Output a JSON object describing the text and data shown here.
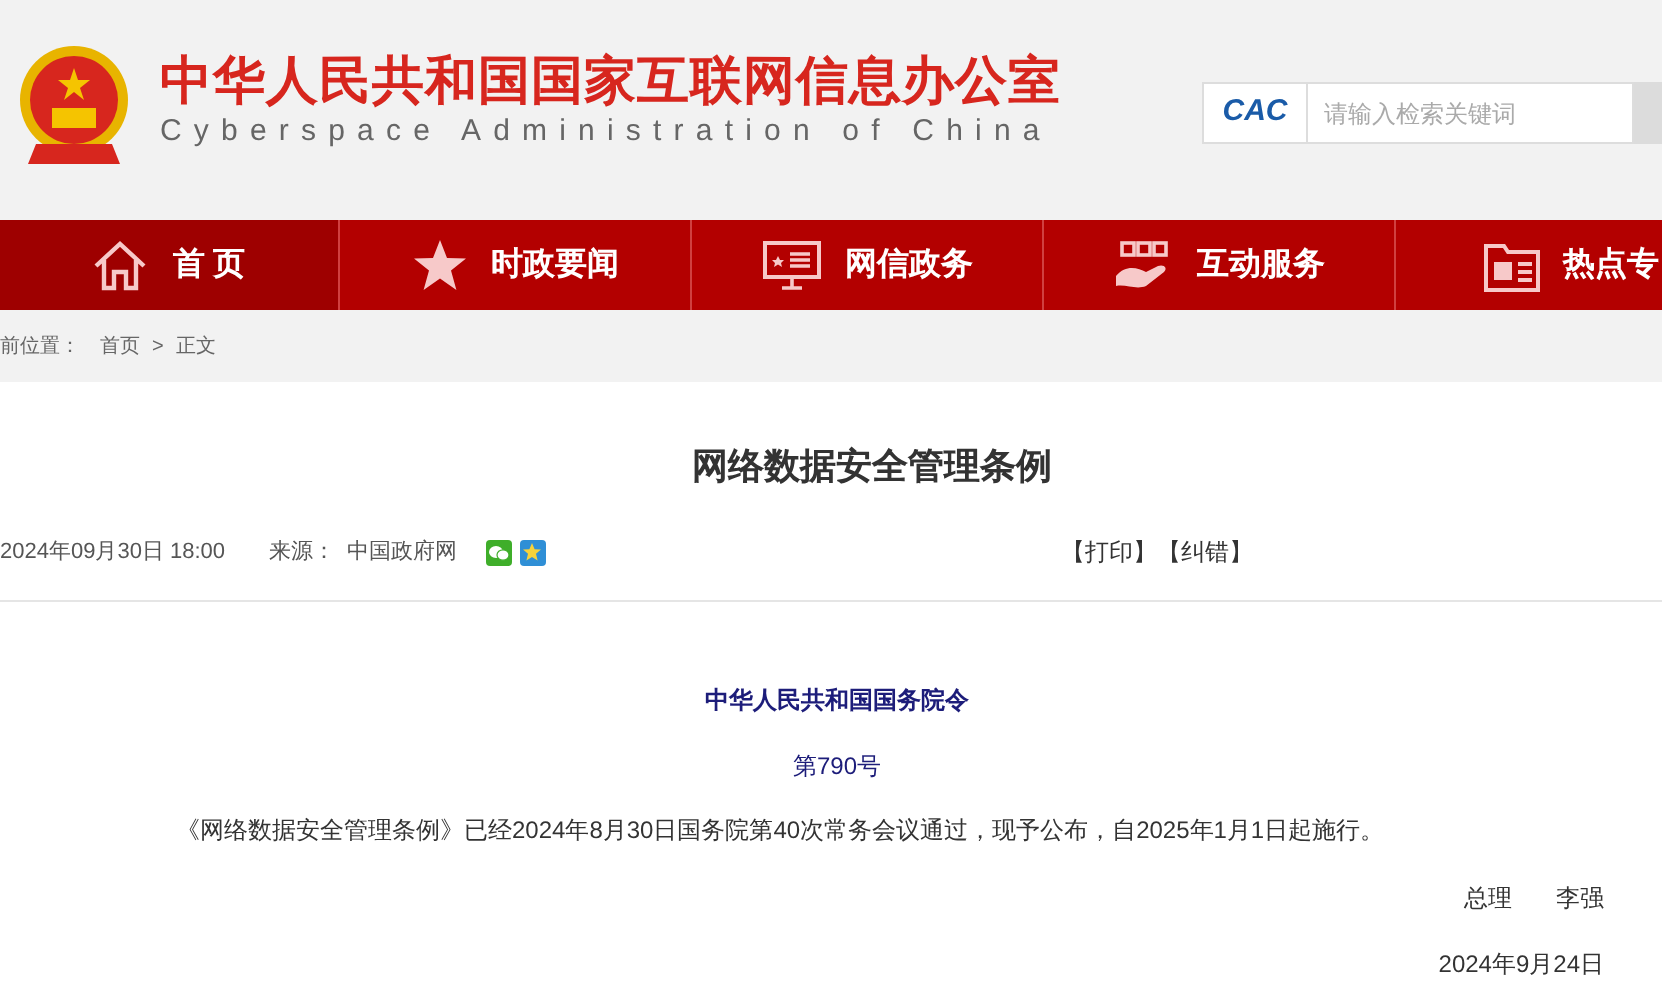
{
  "header": {
    "title": "中华人民共和国国家互联网信息办公室",
    "subtitle": "Cyberspace Administration of China",
    "search": {
      "logo": "CAC",
      "placeholder": "请输入检索关键词"
    }
  },
  "nav": [
    {
      "label": "首 页",
      "selected": true
    },
    {
      "label": "时政要闻",
      "selected": false
    },
    {
      "label": "网信政务",
      "selected": false
    },
    {
      "label": "互动服务",
      "selected": false
    },
    {
      "label": "热点专",
      "selected": false
    }
  ],
  "breadcrumb": {
    "label": "前位置：",
    "items": [
      "首页",
      "正文"
    ],
    "separator": ">"
  },
  "article": {
    "title": "网络数据安全管理条例",
    "date": "2024年09月30日  18:00",
    "source_label": "来源：",
    "source": "中国政府网",
    "actions": [
      "【打印】",
      "【纠错】"
    ],
    "heading": "中华人民共和国国务院令",
    "number": "第790号",
    "body": "《网络数据安全管理条例》已经2024年8月30日国务院第40次常务会议通过，现予公布，自2025年1月1日起施行。",
    "signer_title": "总理",
    "signer": "李强",
    "sign_date": "2024年9月24日"
  }
}
